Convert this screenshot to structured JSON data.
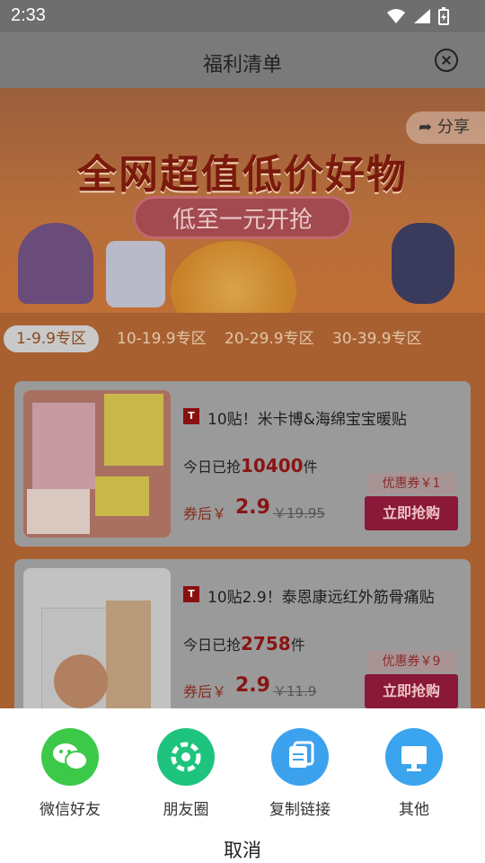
{
  "status_bar": {
    "time": "2:33"
  },
  "header": {
    "title": "福利清单"
  },
  "banner": {
    "headline": "全网超值低价好物",
    "tagline": "低至一元开抢",
    "share_label": "分享"
  },
  "tabs": [
    {
      "label": "1-9.9专区",
      "active": true
    },
    {
      "label": "10-19.9专区",
      "active": false
    },
    {
      "label": "20-29.9专区",
      "active": false
    },
    {
      "label": "30-39.9专区",
      "active": false
    }
  ],
  "products": [
    {
      "title": "10贴！米卡博&海绵宝宝暖贴",
      "sold_prefix": "今日已抢",
      "sold_count": "10400",
      "sold_suffix": "件",
      "price_label": "券后￥",
      "price": "2.9",
      "original_price": "￥19.95",
      "coupon": "优惠券￥1",
      "buy_label": "立即抢购"
    },
    {
      "title": "10贴2.9！泰恩康远红外筋骨痛贴",
      "sold_prefix": "今日已抢",
      "sold_count": "2758",
      "sold_suffix": "件",
      "price_label": "券后￥",
      "price": "2.9",
      "original_price": "￥11.9",
      "coupon": "优惠券￥9",
      "buy_label": "立即抢购"
    }
  ],
  "share_sheet": {
    "options": [
      {
        "label": "微信好友",
        "icon": "wechat-icon",
        "color": "#3cc94a"
      },
      {
        "label": "朋友圈",
        "icon": "moments-icon",
        "color": "#1ec47e"
      },
      {
        "label": "复制链接",
        "icon": "copy-link-icon",
        "color": "#3da2ee"
      },
      {
        "label": "其他",
        "icon": "other-icon",
        "color": "#3aa4ee"
      }
    ],
    "cancel_label": "取消"
  }
}
